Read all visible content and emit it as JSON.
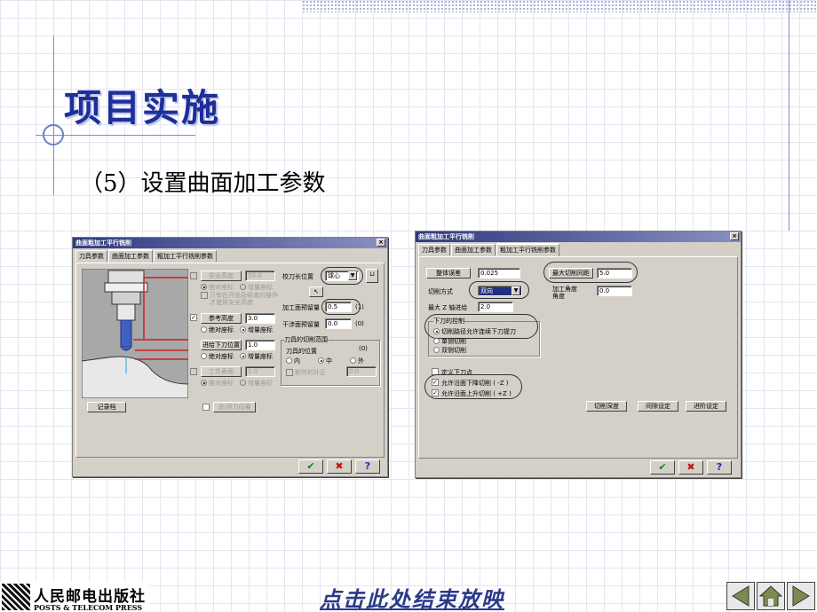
{
  "slide": {
    "title": "项目实施",
    "subtitle": "（5）设置曲面加工参数",
    "publisher_cn": "人民邮电出版社",
    "publisher_en": "POSTS & TELECOM PRESS",
    "end_show_link": "点击此处结束放映"
  },
  "dialog1": {
    "title": "曲面粗加工平行铣削",
    "tabs": [
      "刀具参数",
      "曲面加工参数",
      "粗加工平行铣削参数"
    ],
    "safe_height_label": "安全高度",
    "safe_height_value": "50.0",
    "abs_label": "绝对座标",
    "inc_label": "增量座标",
    "only_start_end": "只有在开始及结束的操作",
    "only_start_end2": "才使用安全高度",
    "ref_height_label": "参考高度",
    "ref_height_value": "3.0",
    "feed_plane_label": "进给下刀位置",
    "feed_plane_value": "1.0",
    "work_surface_label": "工件表面",
    "work_surface_value": "0.0",
    "tip_comp_label": "校刀长位置",
    "tip_comp_value": "球心",
    "stock_drive_label": "加工面预留量",
    "stock_drive_value": "0.5",
    "stock_check_label": "干涉面预留量",
    "stock_check_value": "0.0",
    "boundary_group": "刀具的切削范围",
    "tool_pos_label": "刀具的位置",
    "pos_in": "内",
    "pos_center": "中",
    "pos_out": "外",
    "extra_offset_label": "额外的补正",
    "extra_offset_value": "0.0",
    "record_btn": "记录档",
    "dir_btn": "进/退刀向量"
  },
  "dialog2": {
    "title": "曲面粗加工平行铣削",
    "tabs": [
      "刀具参数",
      "曲面加工参数",
      "粗加工平行铣削参数"
    ],
    "tolerance_label": "整体误差",
    "tolerance_value": "0.025",
    "max_stepover_label": "最大切削间距",
    "max_stepover_value": "5.0",
    "cut_method_label": "切削方式",
    "cut_method_value": "双向",
    "machining_angle_label": "加工角度",
    "machining_angle_value": "0.0",
    "max_stepdown_label": "最大 Z 轴进给",
    "max_stepdown_value": "2.0",
    "plunge_group": "下刀的控制",
    "plunge_opt1": "切削路径允许连续下刀提刀",
    "plunge_opt2": "单侧切削",
    "plunge_opt3": "双侧切削",
    "entry_point": "定义下刀点",
    "allow_neg_z": "允许沿面下降切削 ( -Z )",
    "allow_pos_z": "允许沿面上升切削 ( +Z )",
    "depth_btn": "切削深度",
    "gap_btn": "间隙设定",
    "adv_btn": "进阶设定"
  },
  "colors": {
    "title": "#1e2e9a",
    "ok": "#0b8a1a",
    "cancel": "#c81010"
  }
}
